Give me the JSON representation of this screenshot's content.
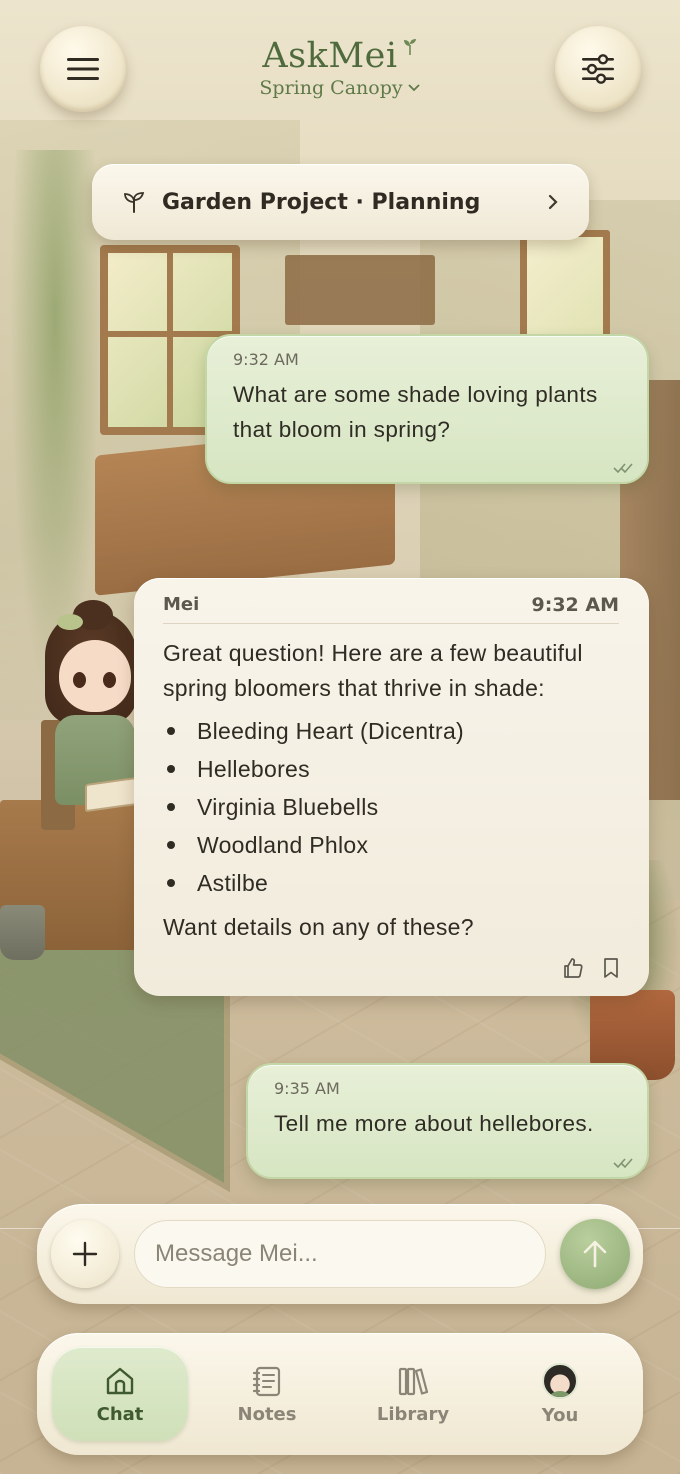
{
  "header": {
    "app_name": "AskMei",
    "theme_name": "Spring Canopy",
    "menu_icon": "hamburger-menu-icon",
    "settings_icon": "sliders-icon"
  },
  "project": {
    "label": "Garden Project · Planning",
    "icon": "sprout-icon"
  },
  "messages": [
    {
      "time": "9:32 AM",
      "text": "What are some shade loving plants that bloom in spring?"
    },
    {
      "sender": "Mei",
      "time": "9:32 AM",
      "intro": "Great question! Here are a few beautiful spring bloomers that thrive in shade:",
      "items": [
        "Bleeding Heart (Dicentra)",
        "Hellebores",
        "Virginia Bluebells",
        "Woodland Phlox",
        "Astilbe"
      ],
      "outro": "Want details on any of these?"
    },
    {
      "time": "9:35 AM",
      "text": "Tell me more about hellebores."
    }
  ],
  "composer": {
    "placeholder": "Message Mei..."
  },
  "tabs": [
    {
      "label": "Chat",
      "icon": "home-icon",
      "active": true
    },
    {
      "label": "Notes",
      "icon": "notes-icon",
      "active": false
    },
    {
      "label": "Library",
      "icon": "library-icon",
      "active": false
    },
    {
      "label": "You",
      "icon": "avatar",
      "active": false
    }
  ],
  "colors": {
    "accent_green": "#4f6a3d",
    "user_bubble": "#d6e5c2",
    "bot_bubble": "#f4efe3",
    "send_button": "#9fb883"
  }
}
